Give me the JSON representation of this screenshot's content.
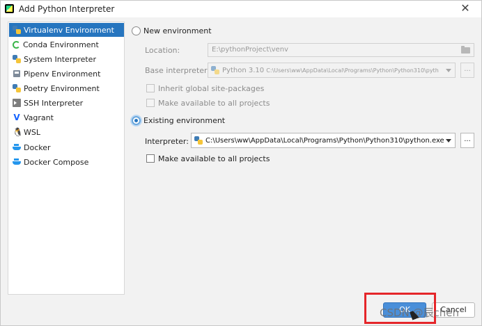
{
  "window": {
    "title": "Add Python Interpreter",
    "close_glyph": "✕"
  },
  "sidebar": {
    "items": [
      {
        "label": "Virtualenv Environment",
        "icon": "python-icon",
        "selected": true
      },
      {
        "label": "Conda Environment",
        "icon": "conda-icon",
        "selected": false
      },
      {
        "label": "System Interpreter",
        "icon": "python-icon",
        "selected": false
      },
      {
        "label": "Pipenv Environment",
        "icon": "pipenv-icon",
        "selected": false
      },
      {
        "label": "Poetry Environment",
        "icon": "poetry-icon",
        "selected": false
      },
      {
        "label": "SSH Interpreter",
        "icon": "ssh-terminal-icon",
        "selected": false
      },
      {
        "label": "Vagrant",
        "icon": "vagrant-icon",
        "selected": false
      },
      {
        "label": "WSL",
        "icon": "linux-tux-icon",
        "selected": false
      },
      {
        "label": "Docker",
        "icon": "docker-icon",
        "selected": false
      },
      {
        "label": "Docker Compose",
        "icon": "docker-compose-icon",
        "selected": false
      }
    ]
  },
  "new_env": {
    "radio_label": "New environment",
    "checked": false,
    "location_label": "Location:",
    "location_value": "E:\\pythonProject\\venv",
    "base_label": "Base interpreter:",
    "base_version": "Python 3.10",
    "base_path": "C:\\Users\\ww\\AppData\\Local\\Programs\\Python\\Python310\\pyth",
    "base_browse": "...",
    "inherit_label": "Inherit global site-packages",
    "inherit_checked": false,
    "available_label": "Make available to all projects",
    "available_checked": false
  },
  "existing_env": {
    "radio_label": "Existing environment",
    "checked": true,
    "interpreter_label": "Interpreter:",
    "interpreter_value": "C:\\Users\\ww\\AppData\\Local\\Programs\\Python\\Python310\\python.exe",
    "browse": "...",
    "available_label": "Make available to all projects",
    "available_checked": false
  },
  "buttons": {
    "ok_label": "OK",
    "cancel_label": "Cancel"
  },
  "overlay": {
    "watermark": "CSDN @辰chen",
    "highlight_color": "#e5262a"
  },
  "colors": {
    "accent": "#2675bf",
    "ok_button": "#4a8fd9"
  }
}
